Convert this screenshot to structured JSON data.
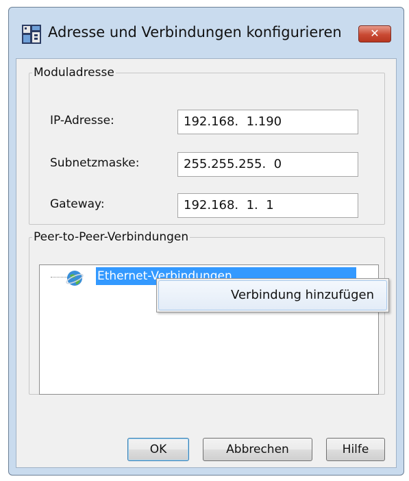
{
  "window": {
    "title": "Adresse und Verbindungen konfigurieren",
    "close_glyph": "✕"
  },
  "module_address": {
    "legend": "Moduladresse",
    "ip": {
      "label": "IP-Adresse:",
      "value": "192.168.  1.190"
    },
    "subnet": {
      "label": "Subnetzmaske:",
      "value": "255.255.255.  0"
    },
    "gateway": {
      "label": "Gateway:",
      "value": "192.168.  1.  1"
    }
  },
  "peer": {
    "legend": "Peer-to-Peer-Verbindungen",
    "tree_item": "Ethernet-Verbindungen",
    "context_menu": {
      "item": "Verbindung hinzufügen"
    }
  },
  "buttons": {
    "ok": "OK",
    "cancel": "Abbrechen",
    "help": "Hilfe"
  },
  "colors": {
    "selection": "#3399ff",
    "close": "#c94a33",
    "frame": "#c9dbee"
  },
  "icons": {
    "app": "network-config-icon",
    "tree": "globe-network-icon"
  }
}
